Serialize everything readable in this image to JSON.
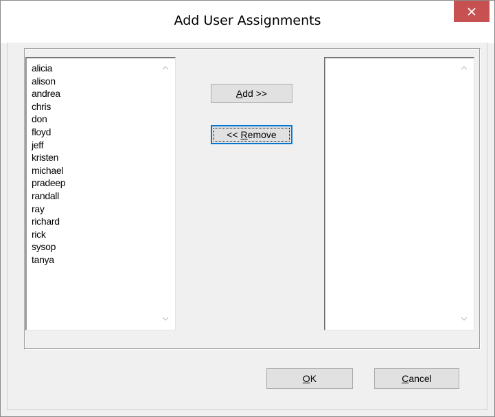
{
  "window": {
    "title": "Add User Assignments"
  },
  "available_users": [
    "alicia",
    "alison",
    "andrea",
    "chris",
    "don",
    "floyd",
    "jeff",
    "kristen",
    "michael",
    "pradeep",
    "randall",
    "ray",
    "richard",
    "rick",
    "sysop",
    "tanya"
  ],
  "assigned_users": [],
  "buttons": {
    "add": {
      "mnemonic": "A",
      "rest": "dd >>"
    },
    "remove": {
      "prefix": "<< ",
      "mnemonic": "R",
      "rest": "emove"
    },
    "ok": {
      "mnemonic": "O",
      "rest": "K"
    },
    "cancel": {
      "mnemonic": "C",
      "rest": "ancel"
    }
  },
  "icons": {
    "close": "close-icon",
    "scroll_up": "chevron-up-icon",
    "scroll_down": "chevron-down-icon"
  },
  "colors": {
    "close_button": "#c75050",
    "focus": "#0078d7",
    "dialog_bg": "#f0f0f0"
  }
}
